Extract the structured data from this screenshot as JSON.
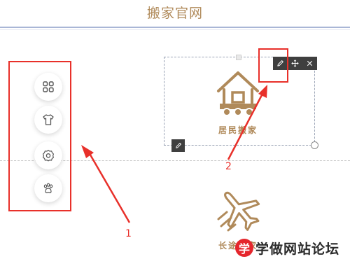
{
  "header": {
    "title": "搬家官网"
  },
  "icon_panel": {
    "items": [
      {
        "icon": "grid-icon"
      },
      {
        "icon": "tshirt-icon"
      },
      {
        "icon": "gear-icon"
      },
      {
        "icon": "paw-icon"
      }
    ]
  },
  "widget": {
    "logo_text": "居民搬家",
    "toolbar": [
      {
        "icon": "pencil-icon"
      },
      {
        "icon": "move-icon"
      },
      {
        "icon": "close-icon"
      }
    ]
  },
  "secondary": {
    "label": "长途搬家"
  },
  "annotations": {
    "callout_1": "1",
    "callout_2": "2"
  },
  "watermark": {
    "badge": "学",
    "text": "学做网站论坛"
  },
  "colors": {
    "brand": "#b08a5a",
    "highlight": "#e8302a",
    "toolbar": "#3f3f3f"
  }
}
